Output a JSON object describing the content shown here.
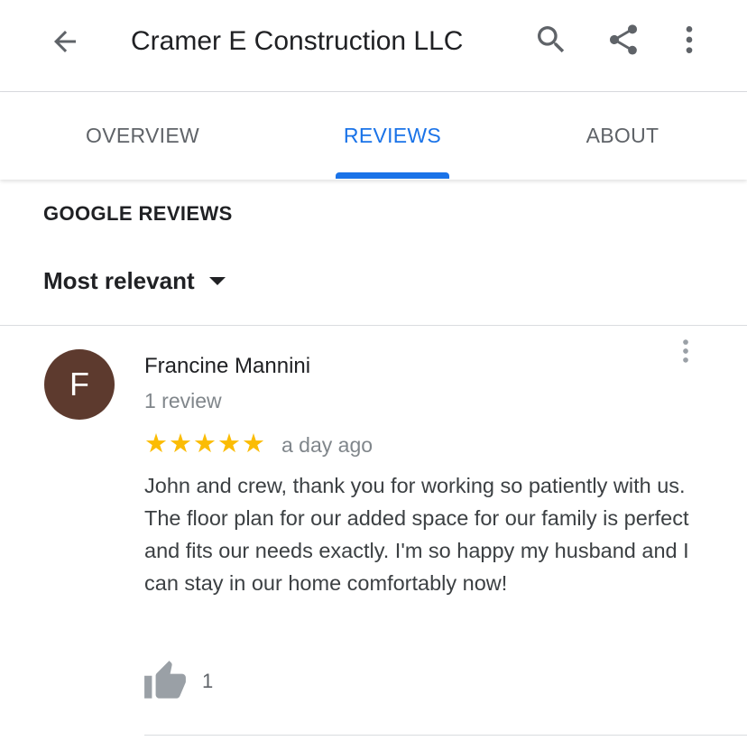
{
  "header": {
    "title": "Cramer E Construction LLC",
    "icons": {
      "back": "back-arrow-icon",
      "search": "search-icon",
      "share": "share-icon",
      "more": "more-vert-icon"
    }
  },
  "tabs": [
    {
      "label": "OVERVIEW",
      "active": false
    },
    {
      "label": "REVIEWS",
      "active": true
    },
    {
      "label": "ABOUT",
      "active": false
    }
  ],
  "section": {
    "heading": "GOOGLE REVIEWS",
    "sort_label": "Most relevant"
  },
  "review": {
    "avatar_letter": "F",
    "avatar_color": "#5d3a2e",
    "reviewer_name": "Francine Mannini",
    "review_count": "1 review",
    "stars": "★★★★★",
    "rating": 5,
    "date": "a day ago",
    "text": "John and crew, thank you for working so patiently with us. The floor plan for our added space for our family is perfect and fits our needs exactly. I'm so happy my husband and I can stay in our home comfortably now!",
    "likes": "1"
  },
  "colors": {
    "accent": "#1a73e8",
    "star": "#fbbc04",
    "secondary_text": "#80868b"
  }
}
